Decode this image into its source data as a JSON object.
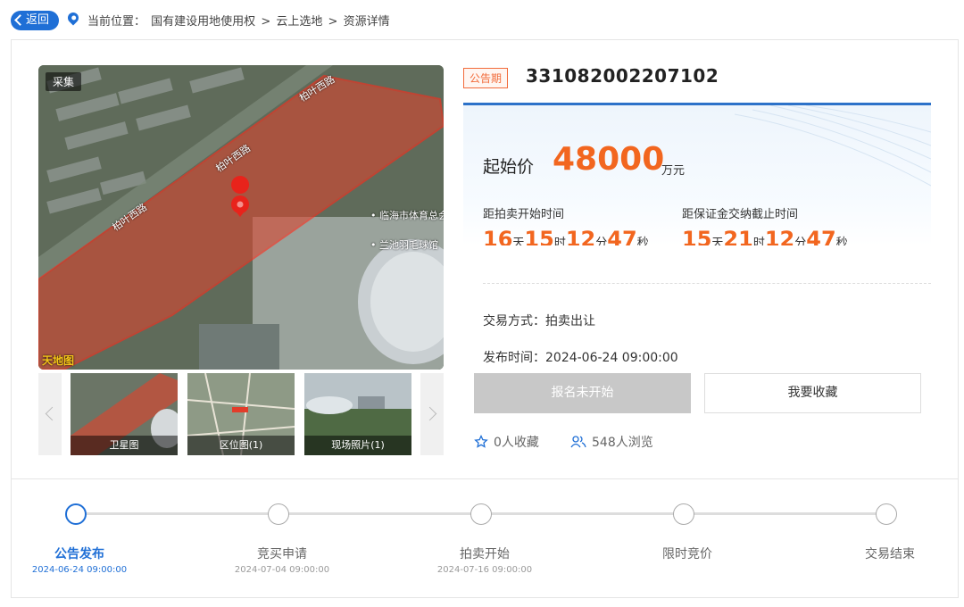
{
  "breadcrumb": {
    "back_label": "返回",
    "prefix": "当前位置：",
    "items": [
      "国有建设用地使用权",
      ">",
      "云上选地",
      ">",
      "资源详情"
    ]
  },
  "gallery": {
    "map_tag": "采集",
    "map_labels": [
      "柏叶西路",
      "柏叶西路",
      "柏叶西路",
      "临海市体育总会",
      "兰池羽毛球馆"
    ],
    "map_watermark": "天地图",
    "thumbnails": [
      "卫星图",
      "区位图(1)",
      "现场照片(1)"
    ]
  },
  "lot": {
    "status_tag": "公告期",
    "number": "331082002207102",
    "start_price_label": "起始价",
    "start_price_value": "48000",
    "start_price_unit": "万元",
    "countdown_auction_label": "距拍卖开始时间",
    "countdown_auction": {
      "days": "16",
      "hours": "15",
      "minutes": "12",
      "seconds": "47"
    },
    "countdown_deposit_label": "距保证金交纳截止时间",
    "countdown_deposit": {
      "days": "15",
      "hours": "21",
      "minutes": "12",
      "seconds": "47"
    },
    "units": {
      "day": "天",
      "hour": "时",
      "minute": "分",
      "second": "秒"
    },
    "trade_method": "交易方式：拍卖出让",
    "publish_time": "发布时间：2024-06-24 09:00:00"
  },
  "actions": {
    "register_label": "报名未开始",
    "favorite_label": "我要收藏",
    "favorites_count": "0人收藏",
    "views_count": "548人浏览"
  },
  "timeline": {
    "steps": [
      {
        "name": "公告发布",
        "date": "2024-06-24 09:00:00",
        "active": true
      },
      {
        "name": "竞买申请",
        "date": "2024-07-04 09:00:00",
        "active": false
      },
      {
        "name": "拍卖开始",
        "date": "2024-07-16 09:00:00",
        "active": false
      },
      {
        "name": "限时竞价",
        "date": "",
        "active": false
      },
      {
        "name": "交易结束",
        "date": "",
        "active": false
      }
    ]
  },
  "colors": {
    "primary": "#1f6fd6",
    "price": "#f2661f",
    "disabled_button": "#c8c8c8"
  }
}
